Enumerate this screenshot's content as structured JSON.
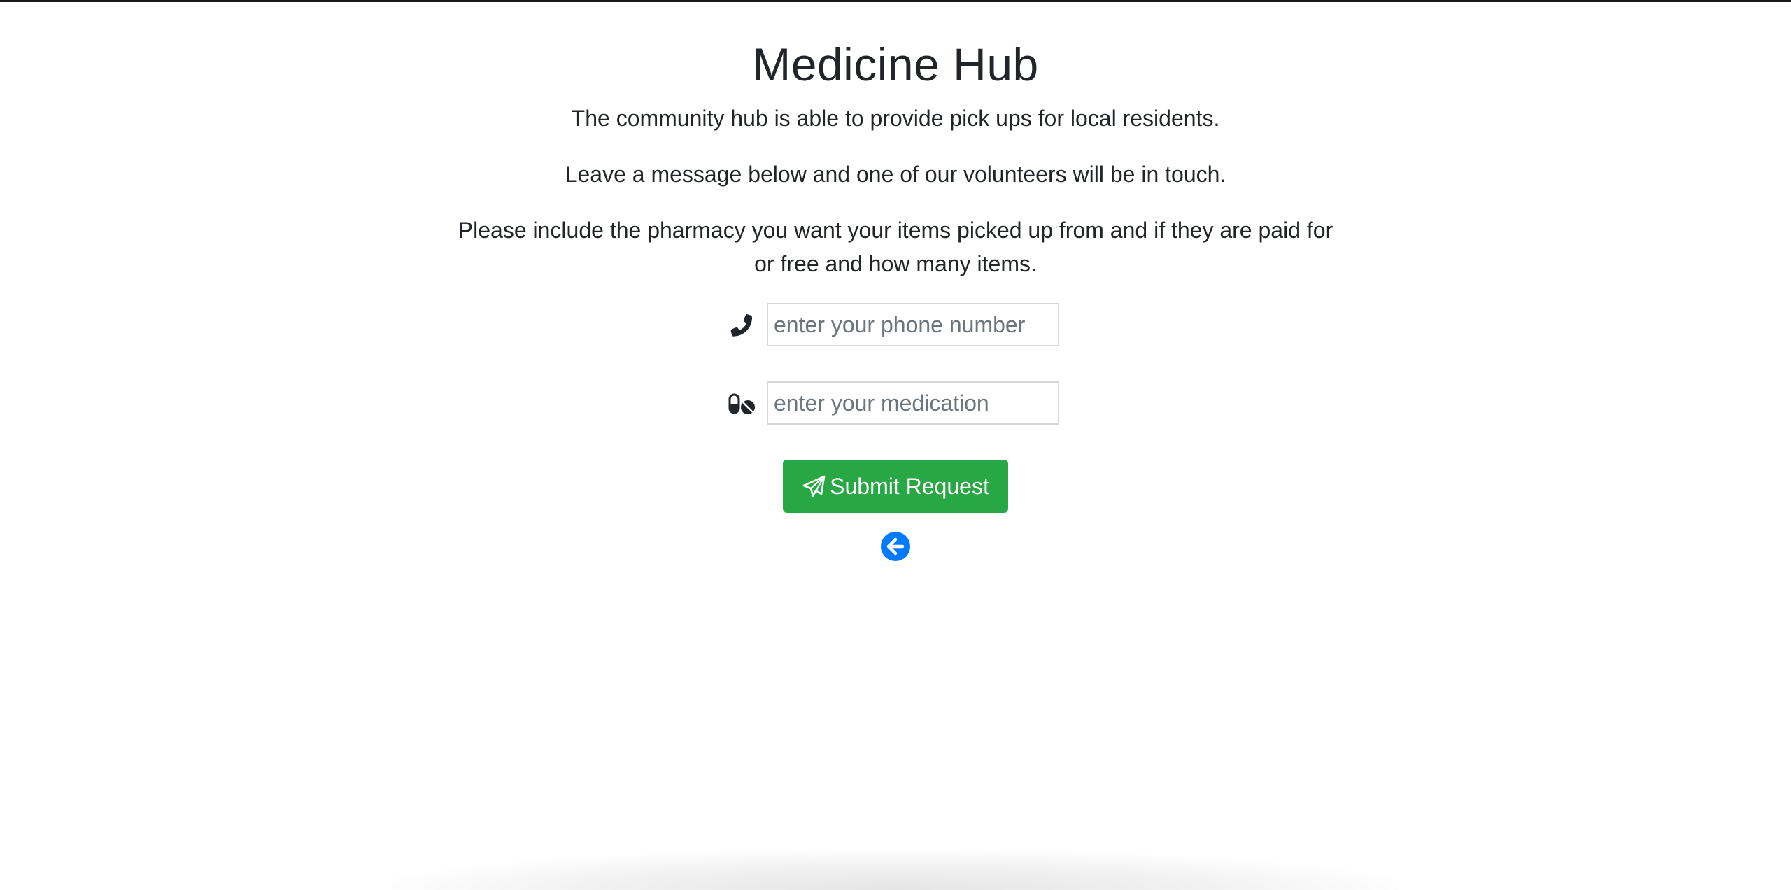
{
  "page": {
    "title": "Medicine Hub",
    "paragraphs": [
      "The community hub is able to provide pick ups for local residents.",
      "Leave a message below and one of our volunteers will be in touch.",
      "Please include the pharmacy you want your items picked up from and if they are paid for or free and how many items."
    ]
  },
  "form": {
    "phone": {
      "icon": "phone-icon",
      "placeholder": "enter your phone number",
      "value": ""
    },
    "medication": {
      "icon": "pills-icon",
      "placeholder": "enter your medication",
      "value": ""
    },
    "submit": {
      "icon": "paper-plane-icon",
      "label": "Submit Request"
    },
    "back": {
      "icon": "arrow-left-circle-icon"
    }
  },
  "colors": {
    "text": "#212529",
    "submit_bg": "#28a745",
    "back_bg": "#007bff",
    "input_border": "#d6d6d6",
    "placeholder": "#6c757d"
  }
}
